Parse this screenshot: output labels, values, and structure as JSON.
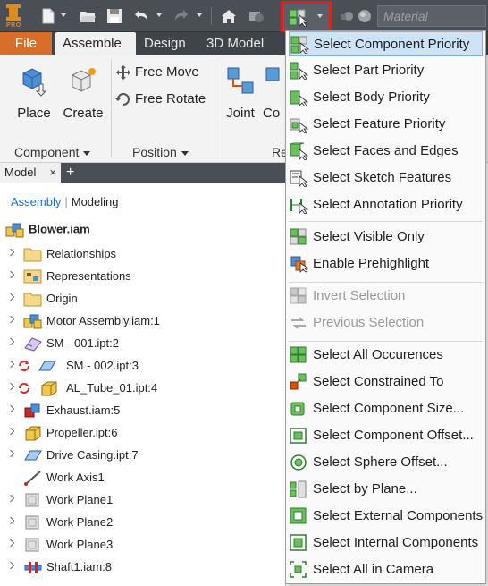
{
  "quick_access": {
    "material_placeholder": "Material",
    "logo_text": "PRO"
  },
  "ribbon_tabs": [
    {
      "label": "File"
    },
    {
      "label": "Assemble"
    },
    {
      "label": "Design"
    },
    {
      "label": "3D Model"
    }
  ],
  "ribbon": {
    "place": "Place",
    "create": "Create",
    "free_move": "Free Move",
    "free_rotate": "Free Rotate",
    "joint": "Joint",
    "constrain_partial": "Co",
    "panel_component": "Component",
    "panel_position": "Position",
    "panel_re_partial": "Re"
  },
  "browser": {
    "tab_label": "Model",
    "tab_close": "×",
    "tab_add": "+",
    "mode_assembly": "Assembly",
    "mode_sep": "|",
    "mode_modeling": "Modeling",
    "root": "Blower.iam",
    "items": [
      {
        "label": "Relationships"
      },
      {
        "label": "Representations"
      },
      {
        "label": "Origin"
      },
      {
        "label": "Motor Assembly.iam:1"
      },
      {
        "label": "SM - 001.ipt:2"
      },
      {
        "label": "SM - 002.ipt:3"
      },
      {
        "label": "AL_Tube_01.ipt:4"
      },
      {
        "label": "Exhaust.iam:5"
      },
      {
        "label": "Propeller.ipt:6"
      },
      {
        "label": "Drive Casing.ipt:7"
      },
      {
        "label": "Work Axis1"
      },
      {
        "label": "Work Plane1"
      },
      {
        "label": "Work Plane2"
      },
      {
        "label": "Work Plane3"
      },
      {
        "label": "Shaft1.iam:8"
      }
    ]
  },
  "menu": {
    "items": [
      {
        "label": "Select Component Priority"
      },
      {
        "label": "Select Part Priority"
      },
      {
        "label": "Select Body Priority"
      },
      {
        "label": "Select Feature Priority"
      },
      {
        "label": "Select Faces and Edges"
      },
      {
        "label": "Select Sketch Features"
      },
      {
        "label": "Select Annotation Priority"
      },
      {
        "label": "Select Visible Only"
      },
      {
        "label": "Enable Prehighlight"
      },
      {
        "label": "Invert Selection"
      },
      {
        "label": "Previous Selection"
      },
      {
        "label": "Select All Occurences"
      },
      {
        "label": "Select Constrained To"
      },
      {
        "label": "Select Component Size..."
      },
      {
        "label": "Select Component Offset..."
      },
      {
        "label": "Select Sphere Offset..."
      },
      {
        "label": "Select by Plane..."
      },
      {
        "label": "Select External Components"
      },
      {
        "label": "Select Internal Components"
      },
      {
        "label": "Select All in Camera"
      }
    ]
  },
  "colors": {
    "file_tab": "#d86e2a",
    "menu_highlight": "#cde3f7",
    "selection_outline": "#e02020"
  }
}
